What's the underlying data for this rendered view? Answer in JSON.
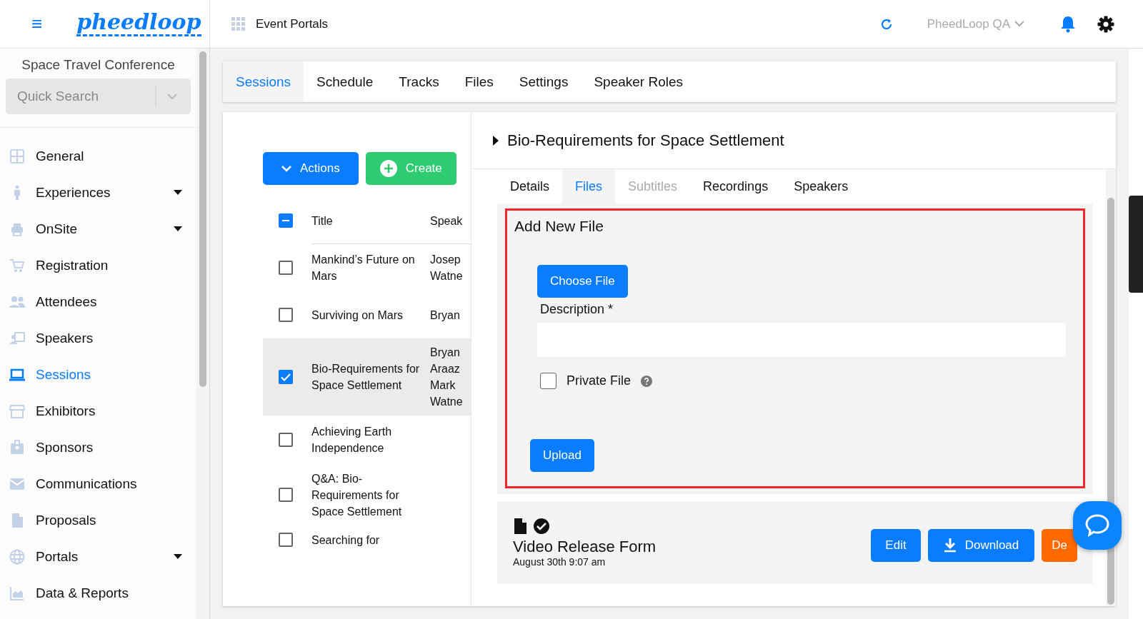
{
  "header": {
    "logo": "pheedloop",
    "menu_icon": "≡",
    "section": "Event Portals",
    "org": "PheedLoop QA"
  },
  "sidebar": {
    "event": "Space Travel Conference",
    "search": {
      "placeholder": "Quick Search"
    },
    "items": [
      {
        "label": "General",
        "expandable": false,
        "selected": false
      },
      {
        "label": "Experiences",
        "expandable": true,
        "selected": false
      },
      {
        "label": "OnSite",
        "expandable": true,
        "selected": false
      },
      {
        "label": "Registration",
        "expandable": false,
        "selected": false
      },
      {
        "label": "Attendees",
        "expandable": false,
        "selected": false
      },
      {
        "label": "Speakers",
        "expandable": false,
        "selected": false
      },
      {
        "label": "Sessions",
        "expandable": false,
        "selected": true
      },
      {
        "label": "Exhibitors",
        "expandable": false,
        "selected": false
      },
      {
        "label": "Sponsors",
        "expandable": false,
        "selected": false
      },
      {
        "label": "Communications",
        "expandable": false,
        "selected": false
      },
      {
        "label": "Proposals",
        "expandable": false,
        "selected": false
      },
      {
        "label": "Portals",
        "expandable": true,
        "selected": false
      },
      {
        "label": "Data & Reports",
        "expandable": false,
        "selected": false
      }
    ]
  },
  "tabs": [
    {
      "label": "Sessions",
      "selected": true
    },
    {
      "label": "Schedule",
      "selected": false
    },
    {
      "label": "Tracks",
      "selected": false
    },
    {
      "label": "Files",
      "selected": false
    },
    {
      "label": "Settings",
      "selected": false
    },
    {
      "label": "Speaker Roles",
      "selected": false
    }
  ],
  "list": {
    "actions": "Actions",
    "create": "Create",
    "columns": [
      "Title",
      "Speak"
    ],
    "header_partial": true,
    "rows": [
      {
        "title": "Mankind’s Future on Mars",
        "speakers": [
          "Josep",
          "Watne"
        ],
        "checked": false,
        "selected": false
      },
      {
        "title": "Surviving on Mars",
        "speakers": [
          "Bryan"
        ],
        "checked": false,
        "selected": false
      },
      {
        "title": "Bio-Requirements for Space Settlement",
        "speakers": [
          "Bryan",
          "Araaz",
          "Mark",
          "Watne"
        ],
        "checked": true,
        "selected": true
      },
      {
        "title": "Achieving Earth Independence",
        "speakers": [],
        "checked": false,
        "selected": false
      },
      {
        "title": "Q&A: Bio-Requirements for Space Settlement",
        "speakers": [],
        "checked": false,
        "selected": false
      },
      {
        "title": "Searching for",
        "speakers": [],
        "checked": false,
        "selected": false
      }
    ]
  },
  "detail": {
    "title": "Bio-Requirements for Space Settlement",
    "tabs": [
      {
        "label": "Details",
        "selected": false,
        "disabled": false
      },
      {
        "label": "Files",
        "selected": true,
        "disabled": false
      },
      {
        "label": "Subtitles",
        "selected": false,
        "disabled": true
      },
      {
        "label": "Recordings",
        "selected": false,
        "disabled": false
      },
      {
        "label": "Speakers",
        "selected": false,
        "disabled": false
      }
    ],
    "form": {
      "title": "Add New File",
      "choose": "Choose File",
      "description_label": "Description *",
      "private_label": "Private File",
      "private_checked": false,
      "upload": "Upload"
    },
    "files": [
      {
        "name": "Video Release Form",
        "date": "August 30th 9:07 am",
        "edit": "Edit",
        "download": "Download",
        "delete": "De"
      }
    ]
  }
}
